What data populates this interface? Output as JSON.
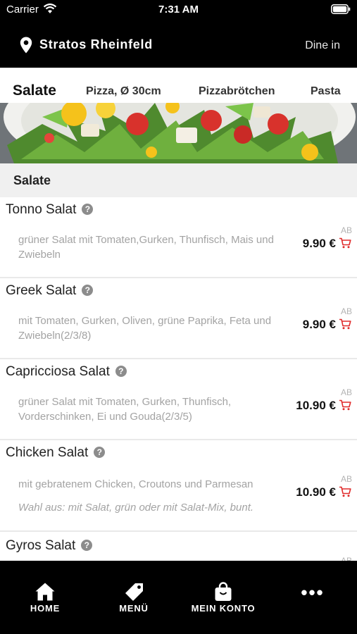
{
  "status_bar": {
    "carrier": "Carrier",
    "time": "7:31 AM"
  },
  "header": {
    "store_name": "Stratos Rheinfeld",
    "mode": "Dine in"
  },
  "tabs": [
    {
      "label": "Salate",
      "active": true
    },
    {
      "label": "Pizza, Ø 30cm",
      "active": false
    },
    {
      "label": "Pizzabrötchen",
      "active": false
    },
    {
      "label": "Pasta",
      "active": false
    }
  ],
  "section": {
    "title": "Salate"
  },
  "items": [
    {
      "name": "Tonno Salat",
      "description": "grüner Salat mit Tomaten,Gurken, Thunfisch, Mais und Zwiebeln",
      "price_from": "AB",
      "price": "9.90 €"
    },
    {
      "name": "Greek Salat",
      "description": "mit Tomaten, Gurken, Oliven, grüne Paprika, Feta und Zwiebeln(2/3/8)",
      "price_from": "AB",
      "price": "9.90 €"
    },
    {
      "name": "Capricciosa Salat",
      "description": "grüner Salat mit Tomaten, Gurken, Thunfisch, Vorderschinken, Ei und Gouda(2/3/5)",
      "price_from": "AB",
      "price": "10.90 €"
    },
    {
      "name": "Chicken Salat",
      "description": "mit gebratenem Chicken, Croutons und Parmesan",
      "note": "Wahl aus: mit Salat, grün oder mit Salat-Mix, bunt.",
      "price_from": "AB",
      "price": "10.90 €"
    },
    {
      "name": "Gyros Salat",
      "description": "",
      "price_from": "AB",
      "price": ""
    }
  ],
  "bottom_nav": [
    {
      "label": "HOME",
      "icon": "home-icon"
    },
    {
      "label": "MENÜ",
      "icon": "tag-icon"
    },
    {
      "label": "MEIN KONTO",
      "icon": "shopping-bag-icon"
    },
    {
      "label": "",
      "icon": "more-dots-icon"
    }
  ],
  "colors": {
    "accent_cart": "#e02b2b",
    "header_bg": "#000000",
    "section_bg": "#f0f0f0"
  }
}
